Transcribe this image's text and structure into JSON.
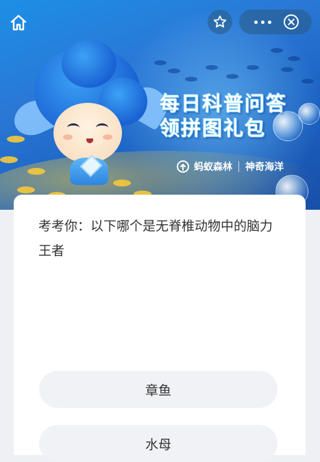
{
  "banner": {
    "title_line1": "每日科普问答",
    "title_line2": "领拼图礼包",
    "brand_left": "蚂蚁森林",
    "brand_right": "神奇海洋"
  },
  "nav": {
    "home_icon": "home-icon",
    "favorite_icon": "star-icon",
    "more_icon": "more-icon",
    "close_icon": "close-icon"
  },
  "quiz": {
    "question": "考考你：以下哪个是无脊椎动物中的脑力王者",
    "options": [
      "章鱼",
      "水母"
    ]
  },
  "colors": {
    "banner_blue": "#2a78d6",
    "option_bg": "#f1f2f5",
    "text": "#333333"
  }
}
